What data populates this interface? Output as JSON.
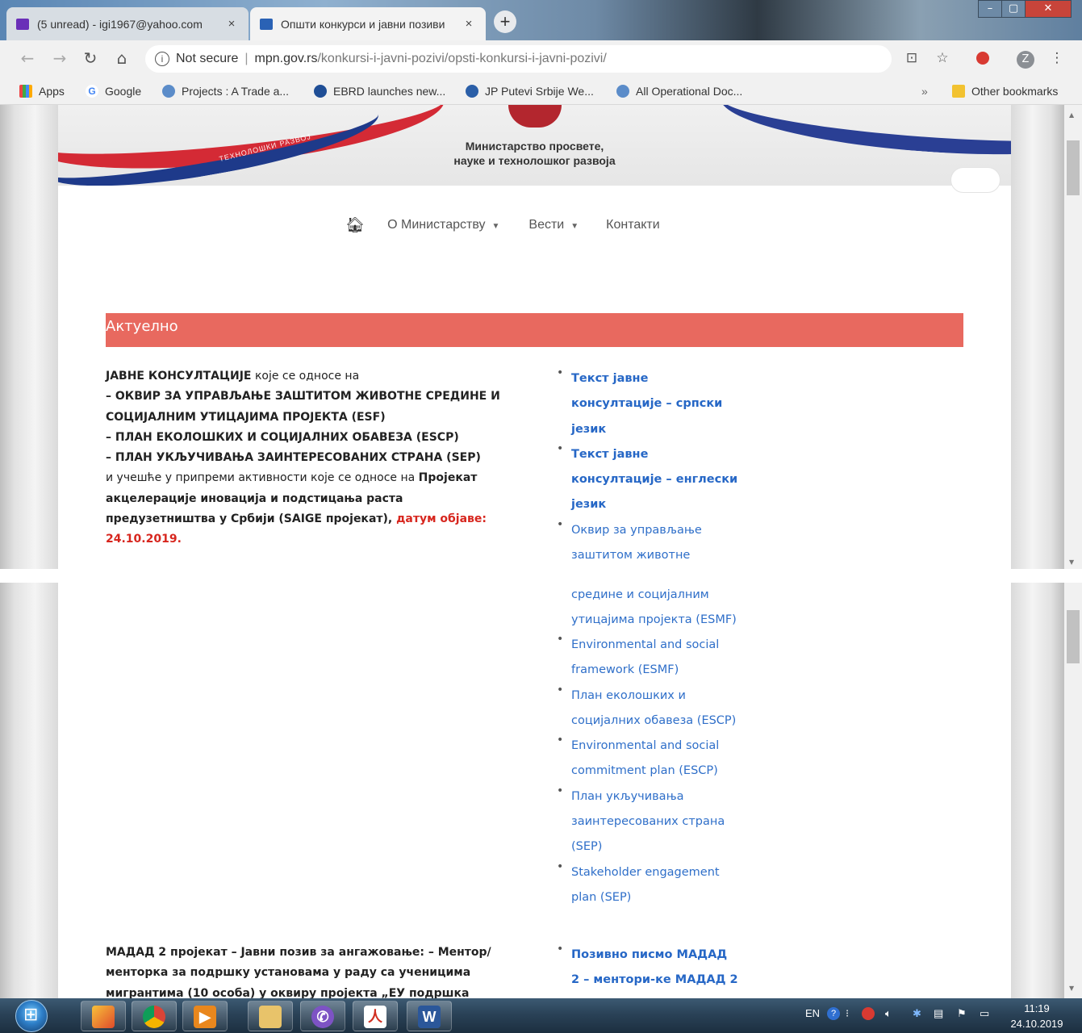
{
  "browser": {
    "tabs": [
      {
        "title": "(5 unread) - igi1967@yahoo.com",
        "close": "×"
      },
      {
        "title": "Општи конкурси и јавни позиви",
        "close": "×"
      }
    ],
    "new_tab": "+",
    "window_controls": [
      "–",
      "▢",
      "✕"
    ],
    "address": {
      "security": "Not secure",
      "host": "mpn.gov.rs",
      "path": "/konkursi-i-javni-pozivi/opsti-konkursi-i-javni-pozivi/"
    },
    "profile_letter": "Z",
    "bookmarks": [
      {
        "label": "Apps",
        "icon": "apps-grid-icon"
      },
      {
        "label": "Google",
        "icon": "google-icon"
      },
      {
        "label": "Projects : A Trade a...",
        "icon": "globe-icon"
      },
      {
        "label": "EBRD launches new...",
        "icon": "ebrd-icon"
      },
      {
        "label": "JP Putevi Srbije We...",
        "icon": "putevi-icon"
      },
      {
        "label": "All Operational Doc...",
        "icon": "globe-icon"
      }
    ],
    "bookmarks_overflow": "»",
    "other_bookmarks": "Other bookmarks"
  },
  "site": {
    "ministry_line1": "Министарство просвете,",
    "ministry_line2": "науке и технолошког развоја",
    "banner_tag": "ТЕХНОЛОШКИ РАЗВОЈ",
    "menu": [
      {
        "label": "О Министарству",
        "caret": "⌄"
      },
      {
        "label": "Вести",
        "caret": "⌄"
      },
      {
        "label": "Контакти"
      }
    ],
    "section_header": "Актуелно"
  },
  "content": {
    "block1": {
      "l1_bold": "ЈАВНЕ КОНСУЛТАЦИЈЕ",
      "l1_rest": " које се односе на",
      "l2": "–  ОКВИР ЗА УПРАВЉАЊЕ ЗАШТИТОМ ЖИВОТНЕ СРЕДИНЕ И",
      "l3": "СОЦИЈАЛНИМ УТИЦАЈИМА ПРОЈЕКТА (ESF)",
      "l4": "–  ПЛАН ЕКОЛОШКИХ И СОЦИЈАЛНИХ ОБАВЕЗА (ESCP)",
      "l5": "–  ПЛАН УКЉУЧИВАЊА ЗАИНТЕРЕСОВАНИХ СТРАНА (SEP)",
      "l6_rest": "и учешће у припреми активности које се односе на ",
      "l6_bold": "Пројекат",
      "l7": "акцелерације иновација и подстицања раста",
      "l8_bold": "предузетништва у Србији (SAIGE пројекат), ",
      "l8_red": "датум објаве:",
      "l9_red": "24.10.2019."
    },
    "links1": [
      {
        "lines": [
          "Текст јавне",
          "консултације – српски",
          "језик"
        ]
      },
      {
        "lines": [
          "Текст јавне",
          "консултације – енглески",
          "језик"
        ]
      },
      {
        "lines": [
          "Оквир за управљање",
          "заштитом животне"
        ]
      }
    ],
    "links1_cont": [
      "средине и социјалним",
      "утицајима пројекта (ESMF)"
    ],
    "links2": [
      {
        "lines": [
          "Environmental and social",
          "framework (ESMF)"
        ]
      },
      {
        "lines": [
          "План еколошких и",
          "социјалних обавеза (ESCP)"
        ]
      },
      {
        "lines": [
          "Environmental and social",
          "commitment plan (ESCP)"
        ]
      },
      {
        "lines": [
          "План укључивања",
          "заинтересованих страна",
          "(SEP)"
        ]
      },
      {
        "lines": [
          "Stakeholder engagement",
          "plan (SEP)"
        ]
      }
    ],
    "block2": {
      "l1": "МАДАД 2 пројекат – Јавни позив за ангажовање: – Ментор/",
      "l2": "менторка за подршку установама у раду са ученицима",
      "l3": "мигрантима (10 особа) у оквиру пројекта „ЕУ подршка"
    },
    "links3": [
      {
        "lines": [
          "Позивно писмо  МАДАД",
          "2 – ментори-ке МАДАД 2"
        ]
      }
    ]
  },
  "taskbar": {
    "apps": [
      "explorer-icon",
      "chrome-icon",
      "media-player-icon",
      "file-explorer-icon",
      "viber-icon",
      "acrobat-icon",
      "word-icon"
    ],
    "lang": "EN",
    "time": "11:19",
    "date": "24.10.2019"
  },
  "colors": {
    "accent": "#e8695f",
    "link": "#2f6fc9",
    "date_red": "#d7261e"
  }
}
